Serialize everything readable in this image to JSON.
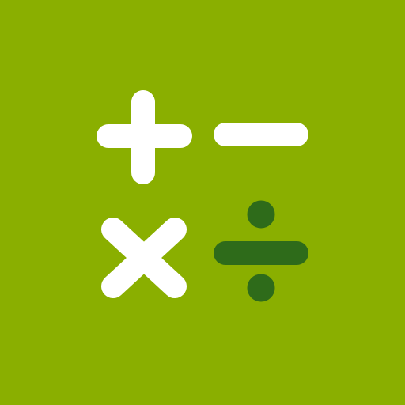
{
  "icon": {
    "background_color": "#8aaf00",
    "symbols": [
      {
        "name": "plus-icon",
        "color": "#ffffff"
      },
      {
        "name": "minus-icon",
        "color": "#ffffff"
      },
      {
        "name": "multiply-icon",
        "color": "#ffffff"
      },
      {
        "name": "divide-icon",
        "color": "#2e6b1a"
      }
    ]
  }
}
